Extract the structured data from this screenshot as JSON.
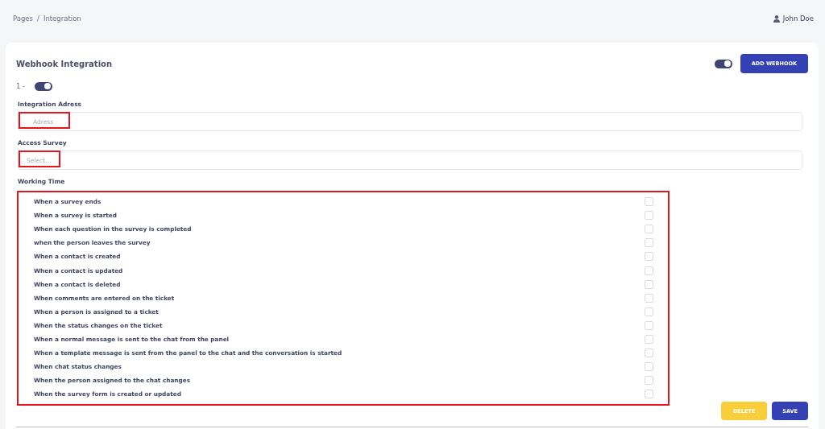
{
  "breadcrumb": [
    "Pages",
    "/",
    "Integration"
  ],
  "user": {
    "name": "John Doe"
  },
  "card": {
    "title": "Webhook Integration",
    "master_toggle": {
      "on": true
    },
    "add_button": "ADD WEBHOOK"
  },
  "webhook": {
    "index": "1 -",
    "enabled": {
      "on": true
    },
    "address": {
      "label": "Integration Adress",
      "placeholder": "Adress",
      "highlighted": true
    },
    "survey": {
      "label": "Access Survey",
      "placeholder": "Select...",
      "highlighted": true
    },
    "working_time": {
      "label": "Working Time",
      "highlighted": true,
      "events": [
        {
          "label": "When a survey ends",
          "checked": false
        },
        {
          "label": "When a survey is started",
          "checked": false
        },
        {
          "label": "When each question in the survey is completed",
          "checked": false
        },
        {
          "label": "when the person leaves the survey",
          "checked": false
        },
        {
          "label": "When a contact is created",
          "checked": false
        },
        {
          "label": "When a contact is updated",
          "checked": false
        },
        {
          "label": "When a contact is deleted",
          "checked": false
        },
        {
          "label": "When comments are entered on the ticket",
          "checked": false
        },
        {
          "label": "When a person is assigned to a ticket",
          "checked": false
        },
        {
          "label": "When the status changes on the ticket",
          "checked": false
        },
        {
          "label": "When a normal message is sent to the chat from the panel",
          "checked": false
        },
        {
          "label": "When a template message is sent from the panel to the chat and the conversation is started",
          "checked": false
        },
        {
          "label": "When chat status changes",
          "checked": false
        },
        {
          "label": "When the person assigned to the chat changes",
          "checked": false
        },
        {
          "label": "When the survey form is created or updated",
          "checked": false
        }
      ]
    }
  },
  "actions": [
    {
      "label": "DELETE",
      "kind": "danger"
    },
    {
      "label": "SAVE",
      "kind": "primary"
    }
  ]
}
